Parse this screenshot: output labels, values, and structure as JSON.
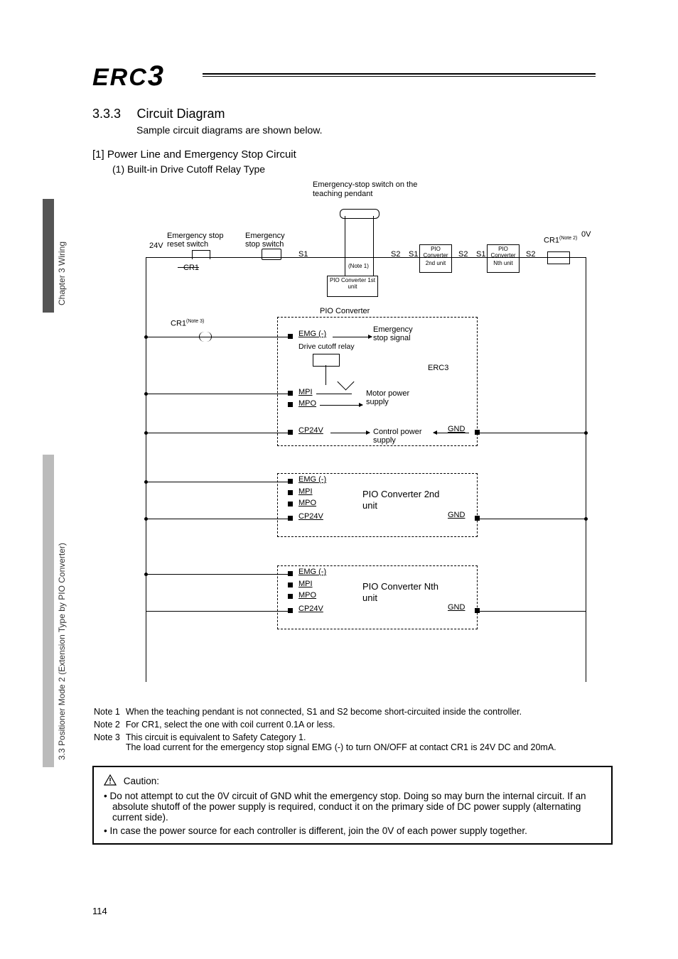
{
  "side": {
    "chapter_label": "Chapter 3 Wiring",
    "section_label": "3.3 Positioner Mode 2 (Extension Type by PIO Converter)"
  },
  "logo": {
    "brand": "ERC",
    "num": "3"
  },
  "section": {
    "number": "3.3.3",
    "title": "Circuit Diagram",
    "subtitle": "Sample circuit diagrams are shown below."
  },
  "sub": {
    "heading": "[1]  Power Line and Emergency Stop Circuit",
    "sub_heading": "(1) Built-in Drive Cutoff Relay Type"
  },
  "diagram": {
    "estop_pendant": "Emergency-stop switch on the teaching pendant",
    "reset_switch": "Emergency stop reset switch",
    "estop_switch": "Emergency stop switch",
    "v24": "24V",
    "v0": "0V",
    "cr1": "CR1",
    "cr1_note2": "CR1",
    "cr1_note2_sup": "(Note 2)",
    "cr1_note3": "CR1",
    "cr1_note3_sup": "(Note 3)",
    "s1": "S1",
    "s2": "S2",
    "note1_small": "(Note 1)",
    "pio_conv": "PIO Converter",
    "pio_conv_1st": "PIO Converter 1st unit",
    "pio_conv_2nd_top": "2nd unit",
    "pio_conv_nth_top": "Nth unit",
    "emg": "EMG (-)",
    "drive_cutoff": "Drive cutoff relay",
    "estop_signal": "Emergency stop signal",
    "erc3": "ERC3",
    "mpi": "MPI",
    "mpo": "MPO",
    "motor_ps": "Motor power supply",
    "cp24v": "CP24V",
    "ctrl_ps": "Control power supply",
    "gnd": "GND",
    "pio_2nd": "PIO Converter 2nd unit",
    "pio_nth": "PIO Converter Nth unit"
  },
  "notes": {
    "n1_label": "Note 1",
    "n1_text": "When the teaching pendant is not connected, S1 and S2 become short-circuited inside the controller.",
    "n2_label": "Note 2",
    "n2_text": "For CR1, select the one with coil current 0.1A or less.",
    "n3_label": "Note 3",
    "n3_text": "This circuit is equivalent to Safety Category 1.",
    "n3_text2": "The load current for the emergency stop signal EMG (-) to turn ON/OFF at contact CR1 is 24V DC and 20mA."
  },
  "caution": {
    "title": "Caution:",
    "b1": "Do not attempt to cut the 0V circuit of GND whit the emergency stop. Doing so may burn the internal circuit. If an absolute shutoff of the power supply is required, conduct it on the primary side of DC power supply (alternating current side).",
    "b2": "In case the power source for each controller is different, join the 0V of each power supply together."
  },
  "page_number": "114"
}
